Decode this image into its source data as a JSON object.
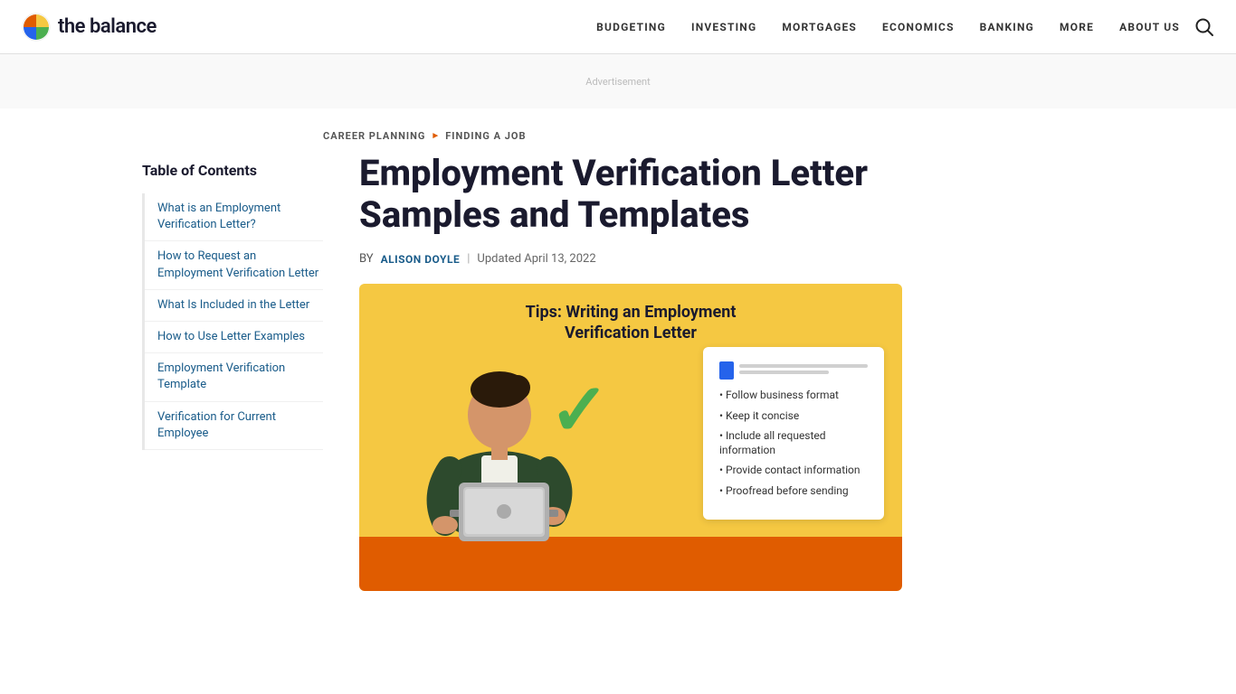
{
  "site": {
    "name": "the balance",
    "logo_alt": "The Balance Logo"
  },
  "nav": {
    "items": [
      {
        "label": "BUDGETING",
        "id": "budgeting"
      },
      {
        "label": "INVESTING",
        "id": "investing"
      },
      {
        "label": "MORTGAGES",
        "id": "mortgages"
      },
      {
        "label": "ECONOMICS",
        "id": "economics"
      },
      {
        "label": "BANKING",
        "id": "banking"
      },
      {
        "label": "MORE",
        "id": "more"
      },
      {
        "label": "ABOUT US",
        "id": "about-us"
      }
    ]
  },
  "breadcrumb": {
    "items": [
      {
        "label": "CAREER PLANNING",
        "id": "career-planning"
      },
      {
        "label": "FINDING A JOB",
        "id": "finding-a-job"
      }
    ]
  },
  "article": {
    "title": "Employment Verification Letter Samples and Templates",
    "byline_prefix": "BY",
    "author": "ALISON DOYLE",
    "date_prefix": "Updated",
    "date": "April 13, 2022",
    "hero_title_line1": "Tips: Writing an Employment",
    "hero_title_line2": "Verification Letter"
  },
  "toc": {
    "title": "Table of Contents",
    "items": [
      {
        "label": "What is an Employment Verification Letter?",
        "id": "what-is"
      },
      {
        "label": "How to Request an Employment Verification Letter",
        "id": "how-to-request"
      },
      {
        "label": "What Is Included in the Letter",
        "id": "what-included"
      },
      {
        "label": "How to Use Letter Examples",
        "id": "how-to-use"
      },
      {
        "label": "Employment Verification Template",
        "id": "template"
      },
      {
        "label": "Verification for Current Employee",
        "id": "current-employee"
      }
    ]
  },
  "checklist": {
    "items": [
      "Follow business format",
      "Keep it concise",
      "Include all requested information",
      "Provide contact information",
      "Proofread before sending"
    ]
  }
}
